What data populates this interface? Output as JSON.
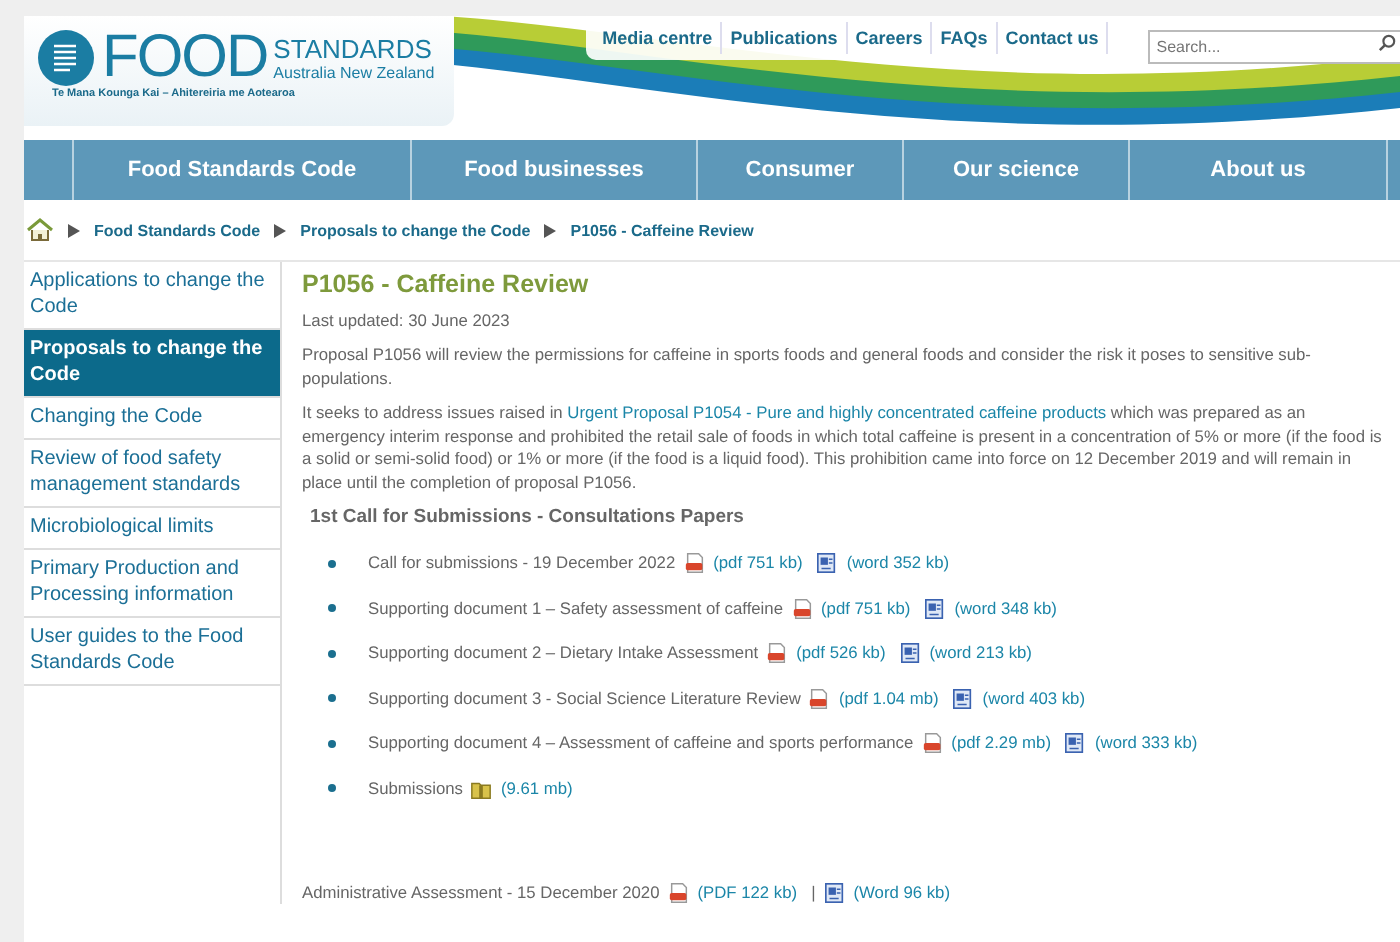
{
  "logo": {
    "word": "FOOD",
    "word2": "STANDARDS",
    "region": "Australia New Zealand",
    "tagline": "Te Mana Kounga Kai – Ahitereiria me Aotearoa"
  },
  "top_links": [
    "Media centre",
    "Publications",
    "Careers",
    "FAQs",
    "Contact us"
  ],
  "search": {
    "placeholder": "Search..."
  },
  "nav": [
    "Food Standards Code",
    "Food businesses",
    "Consumer",
    "Our science",
    "About us"
  ],
  "breadcrumb": [
    "Food Standards Code",
    "Proposals to change the Code",
    "P1056 - Caffeine Review"
  ],
  "sidebar": {
    "items": [
      {
        "label": "Applications to change the Code",
        "selected": false
      },
      {
        "label": "Proposals to change the Code",
        "selected": true
      },
      {
        "label": "Changing the Code",
        "selected": false
      },
      {
        "label": "Review of food safety management standards",
        "selected": false
      },
      {
        "label": "Microbiological limits",
        "selected": false
      },
      {
        "label": "Primary Production and Processing information",
        "selected": false
      },
      {
        "label": "User guides to the Food Standards Code",
        "selected": false
      }
    ]
  },
  "content": {
    "title": "P1056 - Caffeine Review",
    "updated": "Last updated: 30 June 2023",
    "intro": "Proposal P1056 will review the permissions for caffeine in sports foods and general foods and consider the risk it poses to sensitive sub-populations.",
    "para": {
      "before": "It seeks to address issues raised in ",
      "link": "Urgent Proposal P1054 - Pure and highly concentrated caffeine products",
      "after": " which was prepared as an emergency interim response and prohibited the retail sale of foods in which total caffeine is present in a concentration of 5% or more (if the food is a solid or semi-solid food) or 1% or more (if the food is a liquid food). This prohibition came into force on 12 December 2019 and will remain in place until the completion of proposal P1056."
    },
    "section_heading": "1st Call for Submissions - Consultations Papers",
    "documents": [
      {
        "label": "Call for submissions - 19 December 2022",
        "files": [
          {
            "kind": "pdf",
            "label": "(pdf 751 kb)"
          },
          {
            "kind": "word",
            "label": "(word 352 kb)"
          }
        ]
      },
      {
        "label": "Supporting document 1 – Safety assessment of caffeine",
        "files": [
          {
            "kind": "pdf",
            "label": "(pdf 751 kb)"
          },
          {
            "kind": "word",
            "label": "(word 348 kb)"
          }
        ]
      },
      {
        "label": "Supporting document 2 – Dietary Intake Assessment",
        "files": [
          {
            "kind": "pdf",
            "label": "(pdf 526 kb)"
          },
          {
            "kind": "word",
            "label": "(word 213 kb)"
          }
        ]
      },
      {
        "label": "Supporting document 3 - Social Science Literature Review",
        "files": [
          {
            "kind": "pdf",
            "label": "(pdf 1.04 mb)"
          },
          {
            "kind": "word",
            "label": "(word 403 kb)"
          }
        ]
      },
      {
        "label": "Supporting document 4 – Assessment of caffeine and sports performance",
        "files": [
          {
            "kind": "pdf",
            "label": "(pdf 2.29 mb)"
          },
          {
            "kind": "word",
            "label": "(word 333 kb)"
          }
        ]
      },
      {
        "label": "Submissions",
        "files": [
          {
            "kind": "zip",
            "label": "(9.61 mb)"
          }
        ]
      }
    ],
    "admin": {
      "label": "Administrative Assessment - 15 December 2020",
      "separator": "|",
      "files": [
        {
          "kind": "pdf",
          "label": "(PDF 122 kb)"
        },
        {
          "kind": "word",
          "label": "(Word 96 kb)"
        }
      ]
    }
  }
}
